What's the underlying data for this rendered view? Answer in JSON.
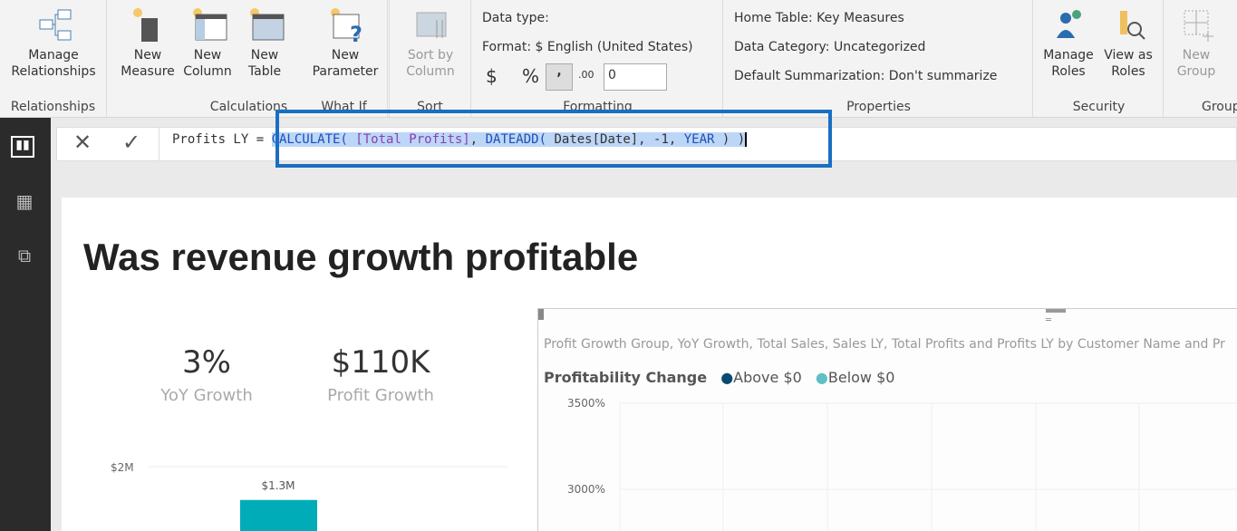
{
  "ribbon": {
    "relationships": {
      "manage": "Manage",
      "manage2": "Relationships",
      "group": "Relationships"
    },
    "calculations": {
      "new_measure": [
        "New",
        "Measure"
      ],
      "new_column": [
        "New",
        "Column"
      ],
      "new_table": [
        "New",
        "Table"
      ],
      "group": "Calculations"
    },
    "whatif": {
      "new_parameter": [
        "New",
        "Parameter"
      ],
      "group": "What If"
    },
    "sort": {
      "sort_by": [
        "Sort by",
        "Column"
      ],
      "group": "Sort"
    },
    "formatting": {
      "data_type": "Data type:",
      "format": "Format: $ English (United States)",
      "currency": "$",
      "percent": "%",
      "comma": ",",
      "decimals_icon": ".00",
      "decimals": "0",
      "group": "Formatting"
    },
    "properties": {
      "home_table": "Home Table: Key Measures",
      "data_category": "Data Category: Uncategorized",
      "summarization": "Default Summarization: Don't summarize",
      "group": "Properties"
    },
    "security": {
      "manage_roles": [
        "Manage",
        "Roles"
      ],
      "view_as": [
        "View as",
        "Roles"
      ],
      "group": "Security"
    },
    "groups": {
      "new_group": [
        "New",
        "Group"
      ],
      "group": "Groups"
    }
  },
  "formula": {
    "name": "Profits LY = ",
    "expr_parts": [
      {
        "t": "CALCULATE(",
        "c": "#1c4fb8"
      },
      {
        "t": " [Total Profits]",
        "c": "#8a3fb0"
      },
      {
        "t": ", ",
        "c": "#333"
      },
      {
        "t": "DATEADD(",
        "c": "#1c4fb8"
      },
      {
        "t": " Dates[Date], -1, ",
        "c": "#333"
      },
      {
        "t": "YEAR",
        "c": "#1c4fb8"
      },
      {
        "t": " ) )",
        "c": "#333"
      }
    ]
  },
  "report": {
    "title": "Was revenue growth profitable",
    "kpis": [
      {
        "value": "3%",
        "label": "YoY Growth"
      },
      {
        "value": "$110K",
        "label": "Profit Growth"
      }
    ],
    "scatter": {
      "subtitle": "Profit Growth Group, YoY Growth, Total Sales, Sales LY, Total Profits and Profits LY by Customer Name and Pr",
      "legend_title": "Profitability Change",
      "legend": [
        {
          "name": "Above $0",
          "color": "#0b4a6e"
        },
        {
          "name": "Below $0",
          "color": "#5fbfc7"
        }
      ]
    }
  },
  "chart_data": [
    {
      "type": "bar",
      "yticks": [
        "$2M"
      ],
      "values": [
        1.3
      ],
      "data_labels": [
        "$1.3M"
      ],
      "color": "#00acb8"
    },
    {
      "type": "scatter",
      "yticks": [
        "3500%",
        "3000%"
      ],
      "series": [
        {
          "name": "Above $0",
          "values": []
        },
        {
          "name": "Below $0",
          "values": []
        }
      ]
    }
  ]
}
